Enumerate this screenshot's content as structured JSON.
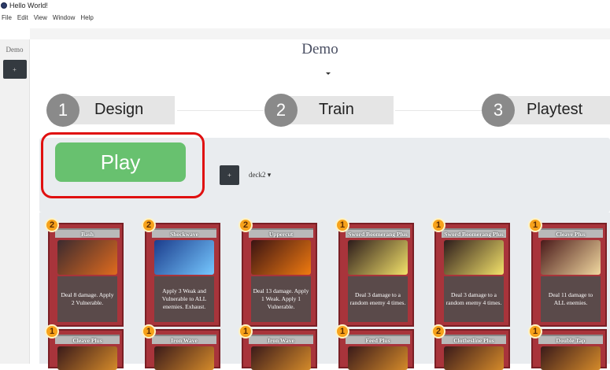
{
  "window": {
    "title": "Hello World!"
  },
  "menu": [
    "File",
    "Edit",
    "View",
    "Window",
    "Help"
  ],
  "sidebar": {
    "item": "Demo",
    "add_label": "+"
  },
  "page": {
    "title": "Demo"
  },
  "steps": [
    {
      "number": "1",
      "label": "Design"
    },
    {
      "number": "2",
      "label": "Train"
    },
    {
      "number": "3",
      "label": "Playtest"
    }
  ],
  "play_label": "Play",
  "deck": {
    "add_label": "+",
    "selected": "deck2 ▾"
  },
  "cards_row1": [
    {
      "cost": "2",
      "name": "Bash",
      "text": "Deal 8 damage. Apply 2 Vulnerable.",
      "art": [
        "#3b2a2f",
        "#e06b1e"
      ]
    },
    {
      "cost": "2",
      "name": "Shockwave",
      "text": "Apply 3 Weak and Vulnerable to ALL enemies. Exhaust.",
      "art": [
        "#1b3c8c",
        "#76c8ff"
      ]
    },
    {
      "cost": "2",
      "name": "Uppercut",
      "text": "Deal 13 damage. Apply 1 Weak. Apply 1 Vulnerable.",
      "art": [
        "#3a1313",
        "#f07a10"
      ]
    },
    {
      "cost": "1",
      "name": "Sword Boomerang Plus",
      "text": "Deal 3 damage to a random enemy 4 times.",
      "art": [
        "#2c1b1b",
        "#f3e26a"
      ]
    },
    {
      "cost": "1",
      "name": "Sword Boomerang Plus",
      "text": "Deal 3 damage to a random enemy 4 times.",
      "art": [
        "#2c1b1b",
        "#f3e26a"
      ]
    },
    {
      "cost": "1",
      "name": "Cleave Plus",
      "text": "Deal 11 damage to ALL enemies.",
      "art": [
        "#4a1a1a",
        "#f1d8a0"
      ]
    }
  ],
  "cards_row2": [
    {
      "cost": "1",
      "name": "Cleave Plus"
    },
    {
      "cost": "1",
      "name": "Iron Wave"
    },
    {
      "cost": "1",
      "name": "Iron Wave"
    },
    {
      "cost": "1",
      "name": "Feed Plus"
    },
    {
      "cost": "2",
      "name": "Clothesline Plus"
    },
    {
      "cost": "1",
      "name": "Double Tap"
    }
  ]
}
